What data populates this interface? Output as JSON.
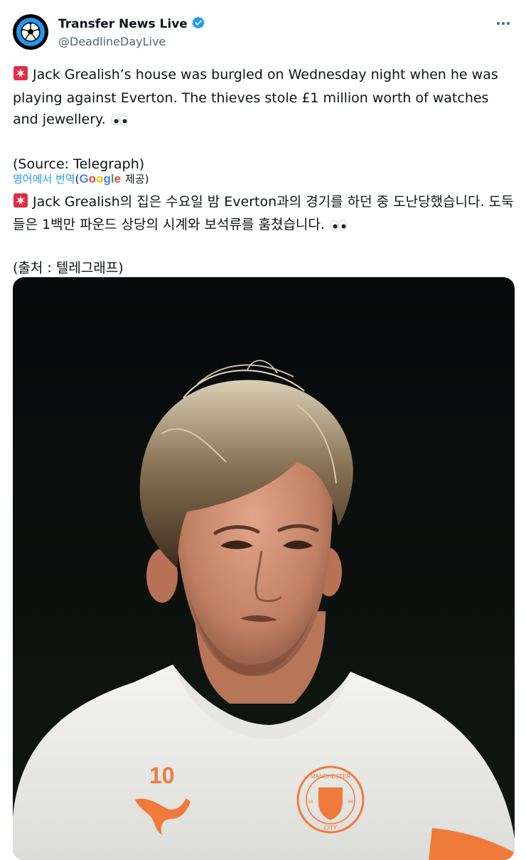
{
  "account": {
    "display_name": "Transfer News Live",
    "handle": "@DeadlineDayLive",
    "verified": true,
    "accent_color": "#1d9bf0"
  },
  "tweet": {
    "line_main": "Jack Grealish’s house was burgled on Wednesday night when he was playing against Everton. The thieves stole £1 million worth of watches and jewellery.",
    "source": "(Source: Telegraph)"
  },
  "translation": {
    "link_label": "영어에서 번역",
    "open_paren": "(",
    "provider_name": "Google",
    "provider_suffix": " 제공)",
    "text": "Jack Grealish의 집은 수요일 밤 Everton과의 경기를 하던 중 도난당했습니다. 도둑들은 1백만 파운드 상당의 시계와 보석류를 훔쳤습니다.",
    "source": "(출처 : 텔레그래프)"
  },
  "media": {
    "jersey_number": "10",
    "crest_text_top": "MANCHESTER",
    "crest_text_bottom": "CITY",
    "crest_year_left": "18",
    "crest_year_right": "94"
  },
  "icons": {
    "siren": "police-light-icon",
    "eyes": "eyes-icon",
    "verified": "verified-badge-icon",
    "more": "more-icon"
  }
}
